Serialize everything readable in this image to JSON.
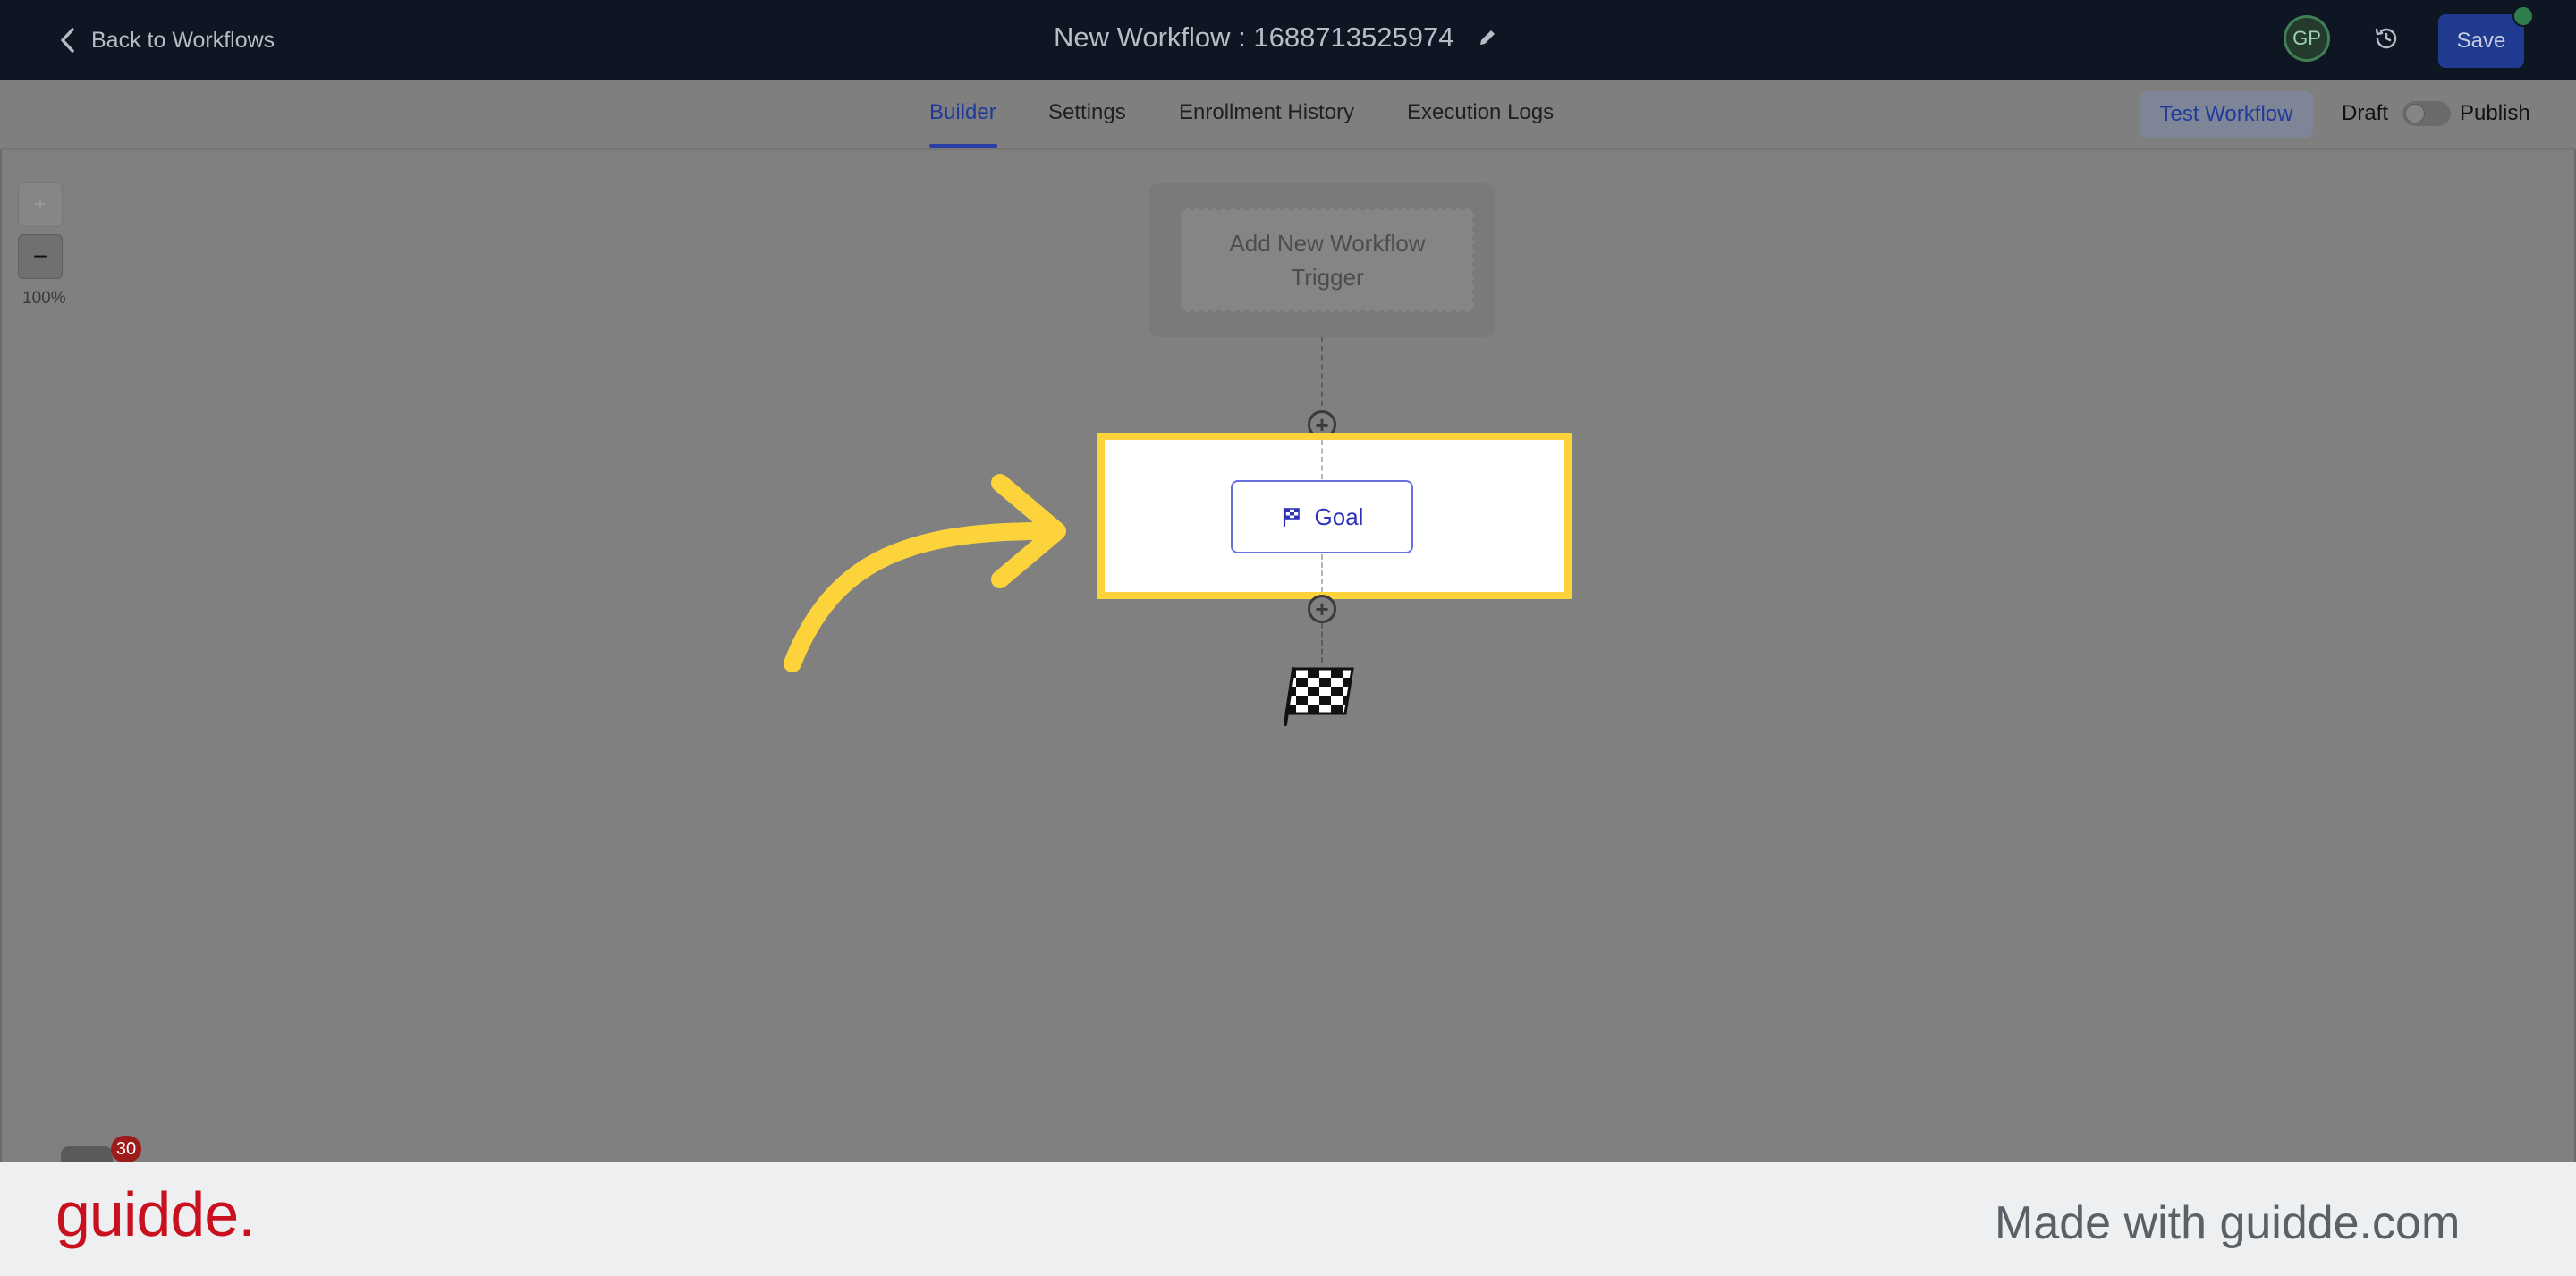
{
  "header": {
    "back_label": "Back to Workflows",
    "workflow_title": "New Workflow : 1688713525974",
    "avatar_initials": "GP",
    "save_label": "Save"
  },
  "tabs": [
    {
      "label": "Builder",
      "active": true
    },
    {
      "label": "Settings",
      "active": false
    },
    {
      "label": "Enrollment History",
      "active": false
    },
    {
      "label": "Execution Logs",
      "active": false
    }
  ],
  "actions": {
    "test_workflow_label": "Test Workflow",
    "draft_label": "Draft",
    "publish_label": "Publish",
    "published": false
  },
  "canvas": {
    "zoom_in_label": "+",
    "zoom_out_label": "−",
    "zoom_level": "100%",
    "trigger_label": "Add New Workflow Trigger",
    "goal_label": "Goal",
    "add_step_symbol": "+"
  },
  "notifications": {
    "count": "30"
  },
  "footer": {
    "brand": "guidde.",
    "made_with": "Made with guidde.com"
  },
  "colors": {
    "highlight": "#fcd33b",
    "arrow": "#fcd33b",
    "save_button": "#1f3a8f",
    "active_tab": "#1f3a9a",
    "goal_border": "#6a6ee0",
    "brand_red": "#c8101e"
  },
  "icons": {
    "back": "chevron-left-icon",
    "edit": "pencil-icon",
    "history": "history-clock-icon",
    "goal": "checkered-flag-icon",
    "end": "finish-flag-icon"
  }
}
